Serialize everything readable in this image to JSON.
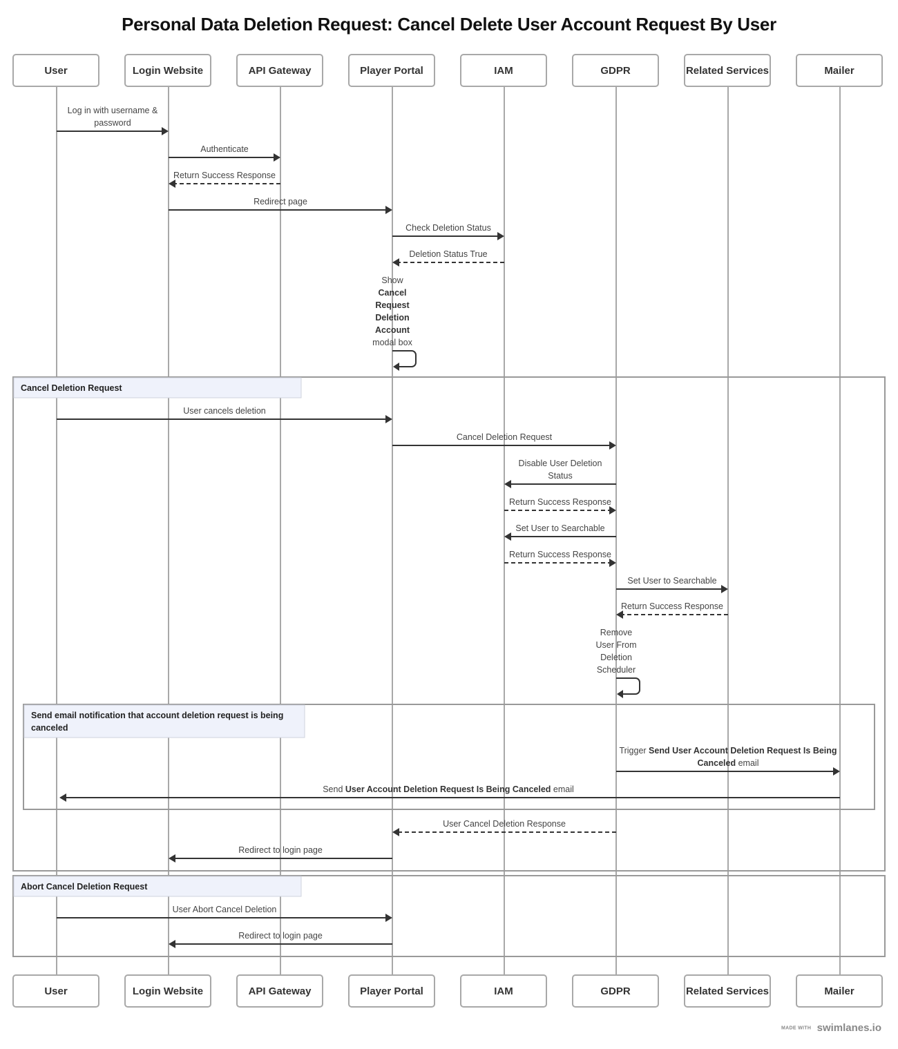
{
  "title": "Personal Data Deletion Request: Cancel Delete User Account Request By User",
  "actors": [
    {
      "id": "user",
      "label": "User"
    },
    {
      "id": "login",
      "label": "Login Website"
    },
    {
      "id": "api",
      "label": "API Gateway"
    },
    {
      "id": "portal",
      "label": "Player Portal"
    },
    {
      "id": "iam",
      "label": "IAM"
    },
    {
      "id": "gdpr",
      "label": "GDPR"
    },
    {
      "id": "related",
      "label": "Related Services"
    },
    {
      "id": "mailer",
      "label": "Mailer"
    }
  ],
  "messages": [
    {
      "from": "user",
      "to": "login",
      "style": "solid",
      "lines": [
        [
          {
            "t": "Log in with username &"
          }
        ],
        [
          {
            "t": "password"
          }
        ]
      ]
    },
    {
      "from": "login",
      "to": "api",
      "style": "solid",
      "lines": [
        [
          {
            "t": "Authenticate"
          }
        ]
      ]
    },
    {
      "from": "api",
      "to": "login",
      "style": "dashed",
      "lines": [
        [
          {
            "t": "Return Success Response"
          }
        ]
      ]
    },
    {
      "from": "login",
      "to": "portal",
      "style": "solid",
      "lines": [
        [
          {
            "t": "Redirect page"
          }
        ]
      ]
    },
    {
      "from": "portal",
      "to": "iam",
      "style": "solid",
      "lines": [
        [
          {
            "t": "Check Deletion Status"
          }
        ]
      ]
    },
    {
      "from": "iam",
      "to": "portal",
      "style": "dashed",
      "lines": [
        [
          {
            "t": "Deletion Status True"
          }
        ]
      ]
    },
    {
      "from": "portal",
      "to": "portal",
      "style": "self",
      "lines": [
        [
          {
            "t": "Show"
          }
        ],
        [
          {
            "t": "Cancel",
            "b": true
          }
        ],
        [
          {
            "t": "Request",
            "b": true
          }
        ],
        [
          {
            "t": "Deletion",
            "b": true
          }
        ],
        [
          {
            "t": "Account",
            "b": true
          }
        ],
        [
          {
            "t": "modal box"
          }
        ]
      ]
    },
    {
      "from": "user",
      "to": "portal",
      "style": "solid",
      "lines": [
        [
          {
            "t": "User cancels deletion"
          }
        ]
      ]
    },
    {
      "from": "portal",
      "to": "gdpr",
      "style": "solid",
      "lines": [
        [
          {
            "t": "Cancel Deletion Request"
          }
        ]
      ]
    },
    {
      "from": "gdpr",
      "to": "iam",
      "style": "solid",
      "lines": [
        [
          {
            "t": "Disable User Deletion"
          }
        ],
        [
          {
            "t": "Status"
          }
        ]
      ]
    },
    {
      "from": "iam",
      "to": "gdpr",
      "style": "dashed",
      "lines": [
        [
          {
            "t": "Return Success Response"
          }
        ]
      ]
    },
    {
      "from": "gdpr",
      "to": "iam",
      "style": "solid",
      "lines": [
        [
          {
            "t": "Set User to Searchable"
          }
        ]
      ]
    },
    {
      "from": "iam",
      "to": "gdpr",
      "style": "dashed",
      "lines": [
        [
          {
            "t": "Return Success Response"
          }
        ]
      ]
    },
    {
      "from": "gdpr",
      "to": "related",
      "style": "solid",
      "lines": [
        [
          {
            "t": "Set User to Searchable"
          }
        ]
      ]
    },
    {
      "from": "related",
      "to": "gdpr",
      "style": "dashed",
      "lines": [
        [
          {
            "t": "Return Success Response"
          }
        ]
      ]
    },
    {
      "from": "gdpr",
      "to": "gdpr",
      "style": "self",
      "lines": [
        [
          {
            "t": "Remove"
          }
        ],
        [
          {
            "t": "User From"
          }
        ],
        [
          {
            "t": "Deletion"
          }
        ],
        [
          {
            "t": "Scheduler"
          }
        ]
      ]
    },
    {
      "from": "gdpr",
      "to": "mailer",
      "style": "solid",
      "lines": [
        [
          {
            "t": "Trigger "
          },
          {
            "t": "Send User Account Deletion Request Is Being",
            "b": true
          }
        ],
        [
          {
            "t": "Canceled",
            "b": true
          },
          {
            "t": " email"
          }
        ]
      ]
    },
    {
      "from": "mailer",
      "to": "user",
      "style": "solid",
      "lines": [
        [
          {
            "t": "Send "
          },
          {
            "t": "User Account Deletion Request Is Being Canceled",
            "b": true
          },
          {
            "t": " email"
          }
        ]
      ]
    },
    {
      "from": "gdpr",
      "to": "portal",
      "style": "dashed",
      "lines": [
        [
          {
            "t": "User Cancel Deletion Response"
          }
        ]
      ]
    },
    {
      "from": "portal",
      "to": "login",
      "style": "solid",
      "lines": [
        [
          {
            "t": "Redirect to login page"
          }
        ]
      ]
    },
    {
      "from": "user",
      "to": "portal",
      "style": "solid",
      "lines": [
        [
          {
            "t": "User Abort Cancel Deletion"
          }
        ]
      ]
    },
    {
      "from": "portal",
      "to": "login",
      "style": "solid",
      "lines": [
        [
          {
            "t": "Redirect to login page"
          }
        ]
      ]
    }
  ],
  "groups": [
    {
      "label_lines": [
        "Cancel Deletion Request"
      ]
    },
    {
      "label_lines": [
        "Send email notification that account deletion request is being",
        "canceled"
      ]
    },
    {
      "label_lines": [
        "Abort Cancel Deletion Request"
      ]
    }
  ],
  "footer": {
    "made_with": "MADE WITH",
    "brand": "swimlanes.io"
  }
}
